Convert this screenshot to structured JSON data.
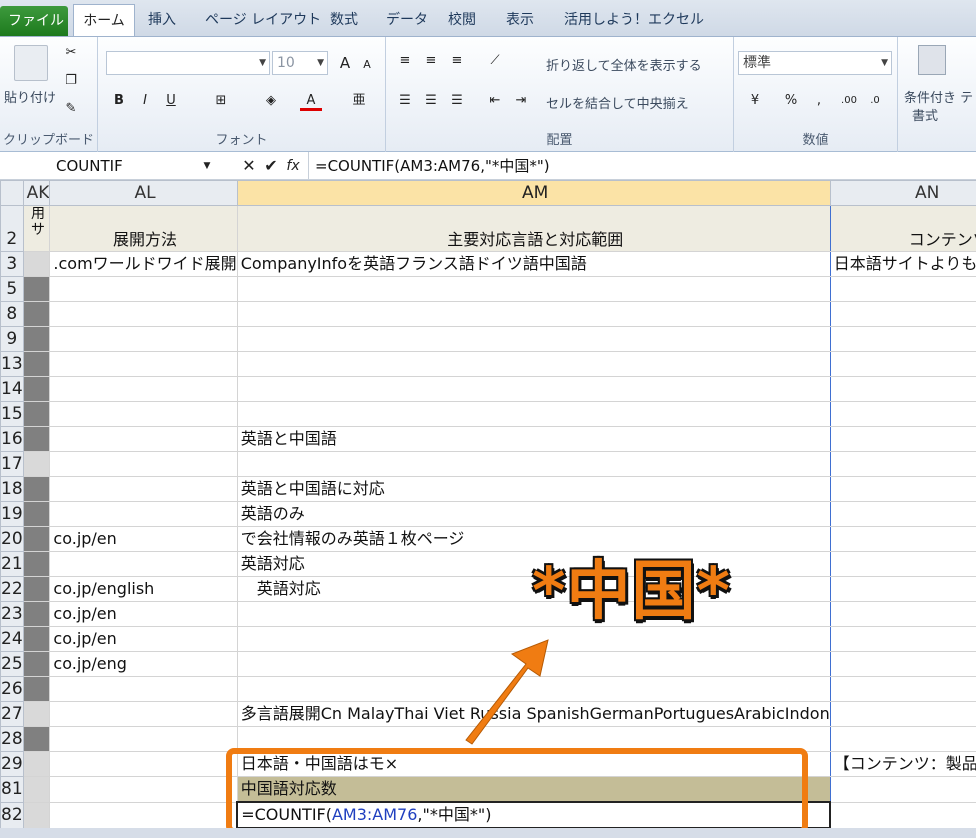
{
  "tabs": {
    "file": "ファイル",
    "home": "ホーム",
    "insert": "挿入",
    "layout": "ページ レイアウト",
    "formulas": "数式",
    "data": "データ",
    "review": "校閲",
    "view": "表示",
    "addin": "活用しよう！エクセル"
  },
  "ribbon": {
    "clipboard": {
      "paste": "貼り付け",
      "label": "クリップボード"
    },
    "font": {
      "size": "10",
      "label": "フォント",
      "bold": "B",
      "italic": "I",
      "underline": "U",
      "grow": "A",
      "shrink": "A",
      "fontcolor": "A"
    },
    "alignment": {
      "wrap": "折り返して全体を表示する",
      "merge": "セルを結合して中央揃え",
      "label": "配置"
    },
    "number": {
      "format": "標準",
      "percent": "%",
      "comma": ",",
      "label": "数値"
    },
    "styles": {
      "cond": "条件付き",
      "cond2": "書式",
      "next": "テ"
    }
  },
  "formula_bar": {
    "name_box": "COUNTIF",
    "fx": "fx",
    "formula": "=COUNTIF(AM3:AM76,\"*中国*\")"
  },
  "columns": [
    "AK",
    "AL",
    "AM",
    "AN"
  ],
  "header_row": {
    "num": "2",
    "ak": "用\nサ",
    "al": "展開方法",
    "am": "主要対応言語と対応範囲",
    "an": "コンテンツ内容"
  },
  "rows": [
    {
      "num": "3",
      "ak": "",
      "al": ".comワールドワイド展開",
      "am": "CompanyInfoを英語フランス語ドイツ語中国語",
      "an": "日本語サイトよりもモ"
    },
    {
      "num": "5",
      "ak": "d",
      "al": "",
      "am": "",
      "an": ""
    },
    {
      "num": "8",
      "ak": "d",
      "al": "",
      "am": "",
      "an": ""
    },
    {
      "num": "9",
      "ak": "d",
      "al": "",
      "am": "",
      "an": ""
    },
    {
      "num": "13",
      "ak": "d",
      "al": "",
      "am": "",
      "an": ""
    },
    {
      "num": "14",
      "ak": "d",
      "al": "",
      "am": "",
      "an": ""
    },
    {
      "num": "15",
      "ak": "d",
      "al": "",
      "am": "",
      "an": ""
    },
    {
      "num": "16",
      "ak": "d",
      "al": "",
      "am": "英語と中国語",
      "an": ""
    },
    {
      "num": "17",
      "ak": "",
      "al": "",
      "am": "",
      "an": ""
    },
    {
      "num": "18",
      "ak": "d",
      "al": "",
      "am": "英語と中国語に対応",
      "an": ""
    },
    {
      "num": "19",
      "ak": "d",
      "al": "",
      "am": "英語のみ",
      "an": ""
    },
    {
      "num": "20",
      "ak": "d",
      "al": "co.jp/en",
      "am": "で会社情報のみ英語１枚ページ",
      "an": ""
    },
    {
      "num": "21",
      "ak": "d",
      "al": "",
      "am": "英語対応",
      "an": ""
    },
    {
      "num": "22",
      "ak": "d",
      "al": "co.jp/english",
      "am": "　英語対応",
      "an": ""
    },
    {
      "num": "23",
      "ak": "d",
      "al": "co.jp/en",
      "am": "",
      "an": ""
    },
    {
      "num": "24",
      "ak": "d",
      "al": "co.jp/en",
      "am": "",
      "an": ""
    },
    {
      "num": "25",
      "ak": "d",
      "al": "co.jp/eng",
      "am": "",
      "an": ""
    },
    {
      "num": "26",
      "ak": "d",
      "al": "",
      "am": "",
      "an": ""
    },
    {
      "num": "27",
      "ak": "",
      "al": "",
      "am": "多言語展開Cn MalayThai Viet Russia SpanishGermanPortuguesArabicIndon",
      "an": ""
    },
    {
      "num": "28",
      "ak": "d",
      "al": "",
      "am": "",
      "an": ""
    },
    {
      "num": "29",
      "ak": "",
      "al": "",
      "am": "日本語・中国語はモ×",
      "an": "【コンテンツ：製品ペ"
    },
    {
      "num": "81",
      "ak": "",
      "al": "",
      "am": "中国語対応数",
      "an": ""
    }
  ],
  "active_row": {
    "num": "82",
    "pre": "=COUNTIF(",
    "ref": "AM3:AM76",
    "post": ",\"*中国*\")"
  },
  "callout": {
    "text": "*中国*"
  },
  "colors": {
    "accent": "#f07c12",
    "file_tab": "#2a8a2a",
    "selected_header": "#fbe3a6"
  }
}
